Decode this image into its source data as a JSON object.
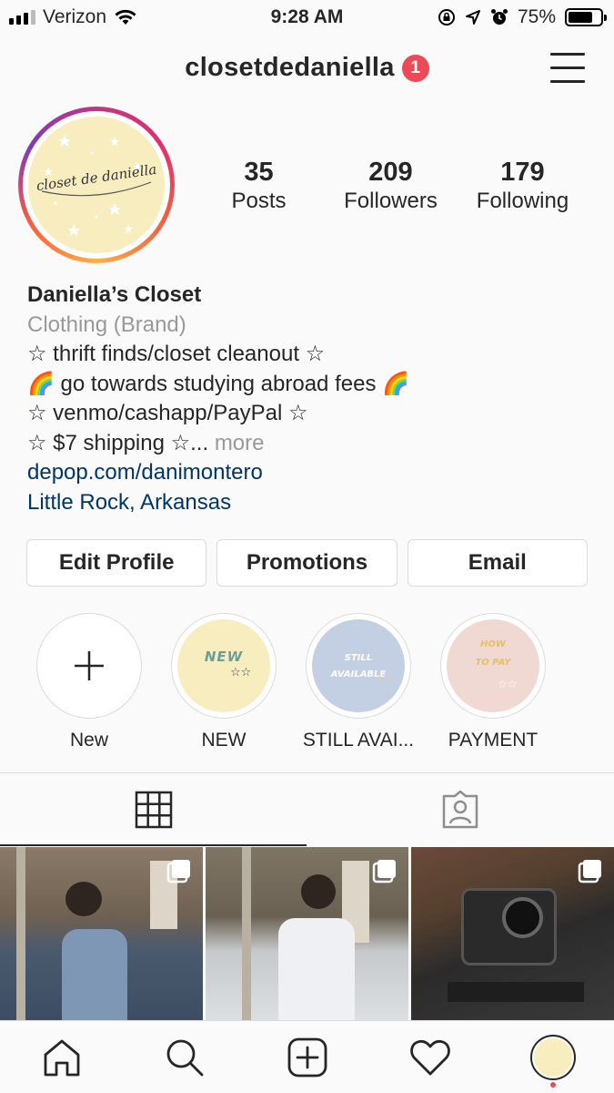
{
  "status_bar": {
    "carrier": "Verizon",
    "time": "9:28 AM",
    "battery": "75%",
    "battery_level": 0.75,
    "icons": [
      "signal-icon",
      "wifi-icon",
      "orientation-lock-icon",
      "location-icon",
      "alarm-icon",
      "battery-icon"
    ]
  },
  "header": {
    "username": "closetdedaniella",
    "notification_count": "1"
  },
  "profile": {
    "avatar_logo_text": "closet de daniella",
    "stats": [
      {
        "value": "35",
        "label": "Posts"
      },
      {
        "value": "209",
        "label": "Followers"
      },
      {
        "value": "179",
        "label": "Following"
      }
    ],
    "name": "Daniella’s Closet",
    "category": "Clothing (Brand)",
    "bio_lines": [
      "☆ thrift finds/closet cleanout ☆",
      "🌈 go towards studying abroad fees 🌈",
      "☆ venmo/cashapp/PayPal ☆",
      "☆ $7 shipping ☆..."
    ],
    "more": "more",
    "website": "depop.com/danimontero",
    "location": "Little Rock, Arkansas"
  },
  "buttons": {
    "edit_profile": "Edit Profile",
    "promotions": "Promotions",
    "email": "Email"
  },
  "highlights": [
    {
      "label": "New",
      "image_text": ""
    },
    {
      "label": "NEW",
      "image_text": "NEW"
    },
    {
      "label": "STILL AVAI...",
      "image_text": "STILL AVAILABLE"
    },
    {
      "label": "PAYMENT",
      "image_text": "HOW TO PAY"
    }
  ],
  "colors": {
    "badge": "#ed4956",
    "link": "#003569",
    "secondary_text": "#999999",
    "highlight_new_bg": "#f8edbe",
    "highlight_still_bg": "#c3cfe2",
    "highlight_payment_bg": "#f1d9d3"
  },
  "tabs": [
    "grid-icon",
    "tagged-icon"
  ],
  "bottom_nav": [
    "home-icon",
    "search-icon",
    "add-post-icon",
    "heart-icon",
    "profile-avatar"
  ]
}
